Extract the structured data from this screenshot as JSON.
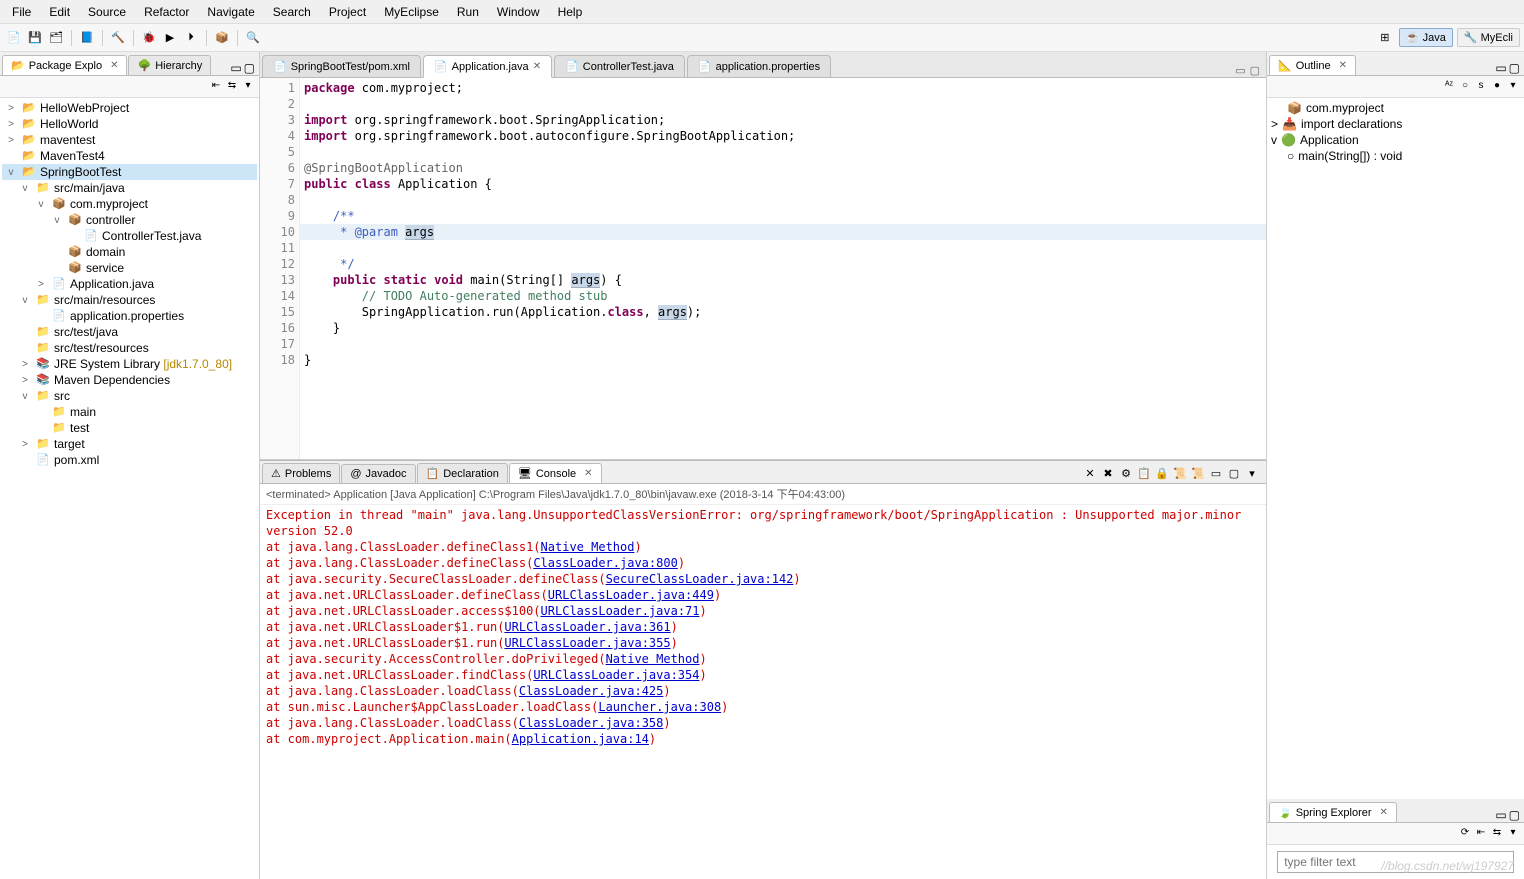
{
  "menu": [
    "File",
    "Edit",
    "Source",
    "Refactor",
    "Navigate",
    "Search",
    "Project",
    "MyEclipse",
    "Run",
    "Window",
    "Help"
  ],
  "perspectives": {
    "java": "Java",
    "myecli": "MyEcli"
  },
  "leftViews": {
    "pkgExplorer": "Package Explo",
    "hierarchy": "Hierarchy"
  },
  "tree": [
    {
      "l": 0,
      "tw": ">",
      "icn": "📂",
      "txt": "HelloWebProject"
    },
    {
      "l": 0,
      "tw": ">",
      "icn": "📂",
      "txt": "HelloWorld"
    },
    {
      "l": 0,
      "tw": ">",
      "icn": "📂",
      "txt": "maventest"
    },
    {
      "l": 0,
      "tw": "",
      "icn": "📂",
      "txt": "MavenTest4"
    },
    {
      "l": 0,
      "tw": "v",
      "icn": "📂",
      "txt": "SpringBootTest",
      "sel": true
    },
    {
      "l": 1,
      "tw": "v",
      "icn": "📁",
      "txt": "src/main/java"
    },
    {
      "l": 2,
      "tw": "v",
      "icn": "📦",
      "txt": "com.myproject"
    },
    {
      "l": 3,
      "tw": "v",
      "icn": "📦",
      "txt": "controller"
    },
    {
      "l": 4,
      "tw": "",
      "icn": "📄",
      "txt": "ControllerTest.java"
    },
    {
      "l": 3,
      "tw": "",
      "icn": "📦",
      "txt": "domain"
    },
    {
      "l": 3,
      "tw": "",
      "icn": "📦",
      "txt": "service"
    },
    {
      "l": 2,
      "tw": ">",
      "icn": "📄",
      "txt": "Application.java"
    },
    {
      "l": 1,
      "tw": "v",
      "icn": "📁",
      "txt": "src/main/resources"
    },
    {
      "l": 2,
      "tw": "",
      "icn": "📄",
      "txt": "application.properties"
    },
    {
      "l": 1,
      "tw": "",
      "icn": "📁",
      "txt": "src/test/java"
    },
    {
      "l": 1,
      "tw": "",
      "icn": "📁",
      "txt": "src/test/resources"
    },
    {
      "l": 1,
      "tw": ">",
      "icn": "📚",
      "txt": "JRE System Library ",
      "extra": "[jdk1.7.0_80]"
    },
    {
      "l": 1,
      "tw": ">",
      "icn": "📚",
      "txt": "Maven Dependencies"
    },
    {
      "l": 1,
      "tw": "v",
      "icn": "📁",
      "txt": "src"
    },
    {
      "l": 2,
      "tw": "",
      "icn": "📁",
      "txt": "main"
    },
    {
      "l": 2,
      "tw": "",
      "icn": "📁",
      "txt": "test"
    },
    {
      "l": 1,
      "tw": ">",
      "icn": "📁",
      "txt": "target"
    },
    {
      "l": 1,
      "tw": "",
      "icn": "📄",
      "txt": "pom.xml"
    }
  ],
  "editorTabs": [
    {
      "icn": "📄",
      "txt": "SpringBootTest/pom.xml",
      "active": false
    },
    {
      "icn": "📄",
      "txt": "Application.java",
      "active": true
    },
    {
      "icn": "📄",
      "txt": "ControllerTest.java",
      "active": false
    },
    {
      "icn": "📄",
      "txt": "application.properties",
      "active": false
    }
  ],
  "code": {
    "lines": [
      1,
      2,
      3,
      4,
      5,
      6,
      7,
      8,
      9,
      10,
      11,
      12,
      13,
      14,
      15,
      16,
      17,
      18
    ]
  },
  "bottomTabs": [
    {
      "txt": "Problems",
      "icn": "⚠"
    },
    {
      "txt": "Javadoc",
      "icn": "@"
    },
    {
      "txt": "Declaration",
      "icn": "📋"
    },
    {
      "txt": "Console",
      "icn": "🖥",
      "active": true
    }
  ],
  "consoleStatus": "<terminated> Application [Java Application] C:\\Program Files\\Java\\jdk1.7.0_80\\bin\\javaw.exe (2018-3-14 下午04:43:00)",
  "console": {
    "head": "Exception in thread \"main\" java.lang.UnsupportedClassVersionError: org/springframework/boot/SpringApplication : Unsupported major.minor version 52.0",
    "stack": [
      {
        "pre": "        at java.lang.ClassLoader.defineClass1(",
        "link": "Native Method",
        "post": ")"
      },
      {
        "pre": "        at java.lang.ClassLoader.defineClass(",
        "link": "ClassLoader.java:800",
        "post": ")"
      },
      {
        "pre": "        at java.security.SecureClassLoader.defineClass(",
        "link": "SecureClassLoader.java:142",
        "post": ")"
      },
      {
        "pre": "        at java.net.URLClassLoader.defineClass(",
        "link": "URLClassLoader.java:449",
        "post": ")"
      },
      {
        "pre": "        at java.net.URLClassLoader.access$100(",
        "link": "URLClassLoader.java:71",
        "post": ")"
      },
      {
        "pre": "        at java.net.URLClassLoader$1.run(",
        "link": "URLClassLoader.java:361",
        "post": ")"
      },
      {
        "pre": "        at java.net.URLClassLoader$1.run(",
        "link": "URLClassLoader.java:355",
        "post": ")"
      },
      {
        "pre": "        at java.security.AccessController.doPrivileged(",
        "link": "Native Method",
        "post": ")"
      },
      {
        "pre": "        at java.net.URLClassLoader.findClass(",
        "link": "URLClassLoader.java:354",
        "post": ")"
      },
      {
        "pre": "        at java.lang.ClassLoader.loadClass(",
        "link": "ClassLoader.java:425",
        "post": ")"
      },
      {
        "pre": "        at sun.misc.Launcher$AppClassLoader.loadClass(",
        "link": "Launcher.java:308",
        "post": ")"
      },
      {
        "pre": "        at java.lang.ClassLoader.loadClass(",
        "link": "ClassLoader.java:358",
        "post": ")"
      },
      {
        "pre": "        at com.myproject.Application.main(",
        "link": "Application.java:14",
        "post": ")"
      }
    ]
  },
  "outlineTitle": "Outline",
  "outline": [
    {
      "l": 1,
      "tw": "",
      "icn": "📦",
      "txt": "com.myproject"
    },
    {
      "l": 0,
      "tw": ">",
      "icn": "📥",
      "txt": "import declarations"
    },
    {
      "l": 0,
      "tw": "v",
      "icn": "🟢",
      "txt": "Application"
    },
    {
      "l": 1,
      "tw": "",
      "icn": "○",
      "txt": "main(String[]) : void"
    }
  ],
  "springTitle": "Spring Explorer",
  "filterPlaceholder": "type filter text",
  "watermark": "//blog.csdn.net/wj197927"
}
